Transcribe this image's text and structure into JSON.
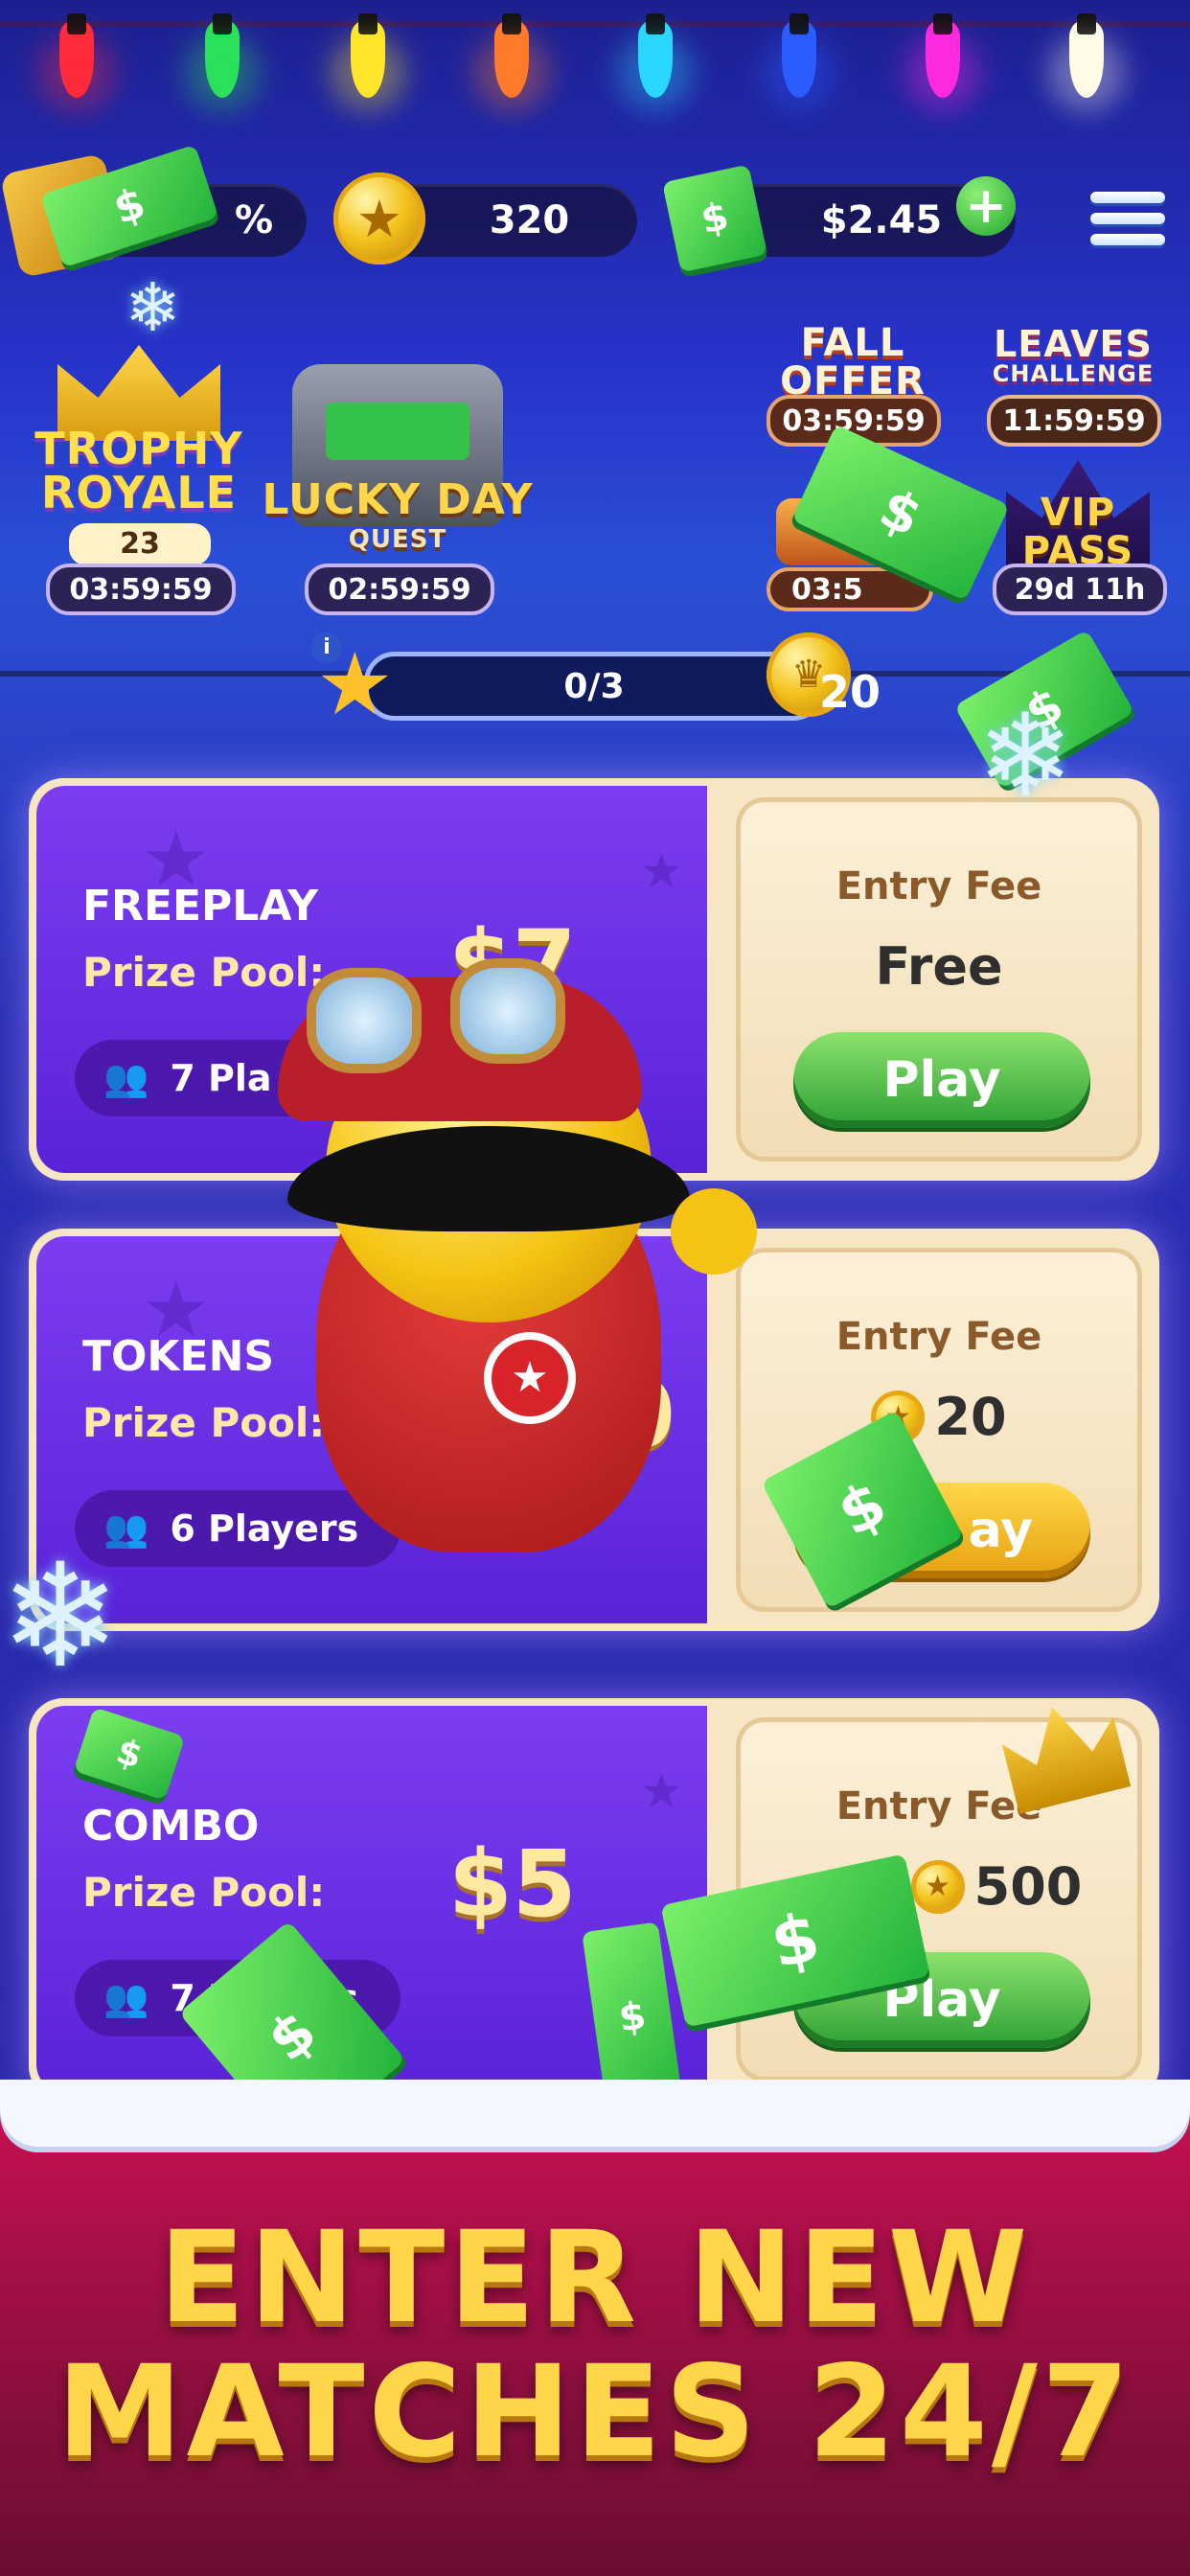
{
  "topbar": {
    "trophy_percent": "%",
    "coins": "320",
    "cash": "$2.45"
  },
  "events": {
    "trophy_royale": {
      "title_1": "TROPHY",
      "title_2": "ROYALE",
      "badge": "23",
      "timer": "03:59:59"
    },
    "lucky_day": {
      "title_1": "LUCKY DAY",
      "title_2": "QUEST",
      "timer": "02:59:59"
    },
    "fall_offer": {
      "title_1": "FALL",
      "title_2": "OFFER",
      "timer": "03:59:59"
    },
    "leaves_challenge": {
      "title_1": "LEAVES",
      "title_2": "CHALLENGE",
      "timer": "11:59:59"
    },
    "day_offer": {
      "timer": "03:5"
    },
    "vip_pass": {
      "title_1": "VIP",
      "title_2": "PASS",
      "timer": "29d 11h"
    }
  },
  "progress": {
    "value": "0/3",
    "reward": "20",
    "fraction": 0
  },
  "matches": [
    {
      "mode": "FREEPLAY",
      "prize_label": "Prize Pool:",
      "prize": "$7",
      "players": "7  Pla",
      "entry_label": "Entry Fee",
      "entry_value": "Free",
      "play": "Play"
    },
    {
      "mode": "TOKENS",
      "prize_label": "Prize Pool:",
      "prize": "0",
      "players": "6  Players",
      "entry_label": "Entry Fee",
      "entry_value": "20",
      "play": "ay"
    },
    {
      "mode": "COMBO",
      "prize_label": "Prize Pool:",
      "prize": "$5",
      "players": "7  Players",
      "entry_label": "Entry Fee",
      "entry_value": "500",
      "play": "Play"
    }
  ],
  "banner": {
    "line1": "ENTER NEW",
    "line2": "MATCHES 24/7"
  },
  "colors": {
    "accent_green": "#2da034",
    "gold": "#ffd64a",
    "banner_red": "#c41052"
  }
}
